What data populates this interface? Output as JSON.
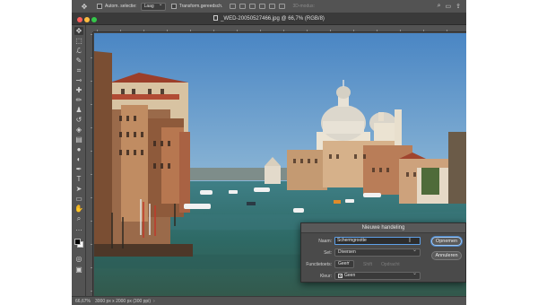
{
  "options_bar": {
    "tool_preset_icon": "move-tool-icon",
    "auto_select_label": "Autom. selectie:",
    "layer_select_value": "Laag",
    "transform_label": "Transform.gereedsch.",
    "mode_3d_label": "3D-modus:"
  },
  "document": {
    "title": "_WED-20050527466.jpg @ 66,7% (RGB/8)"
  },
  "status_bar": {
    "zoom": "66,67%",
    "doc_info": "3000 px x 2000 px (300 ppi)"
  },
  "dialog": {
    "title": "Nieuwe handeling",
    "name_label": "Naam:",
    "name_value": "Schermgrootte",
    "set_label": "Set:",
    "set_value": "Diversen",
    "function_key_label": "Functietoets:",
    "function_key_value": "Geen",
    "shift_label": "Shift",
    "command_label": "Opdracht",
    "color_label": "Kleur:",
    "color_value": "Geen",
    "record_button": "Opnemen",
    "cancel_button": "Annuleren"
  },
  "colors": {
    "accent": "#5ea0e8",
    "panel": "#535353",
    "workspace": "#474747"
  }
}
